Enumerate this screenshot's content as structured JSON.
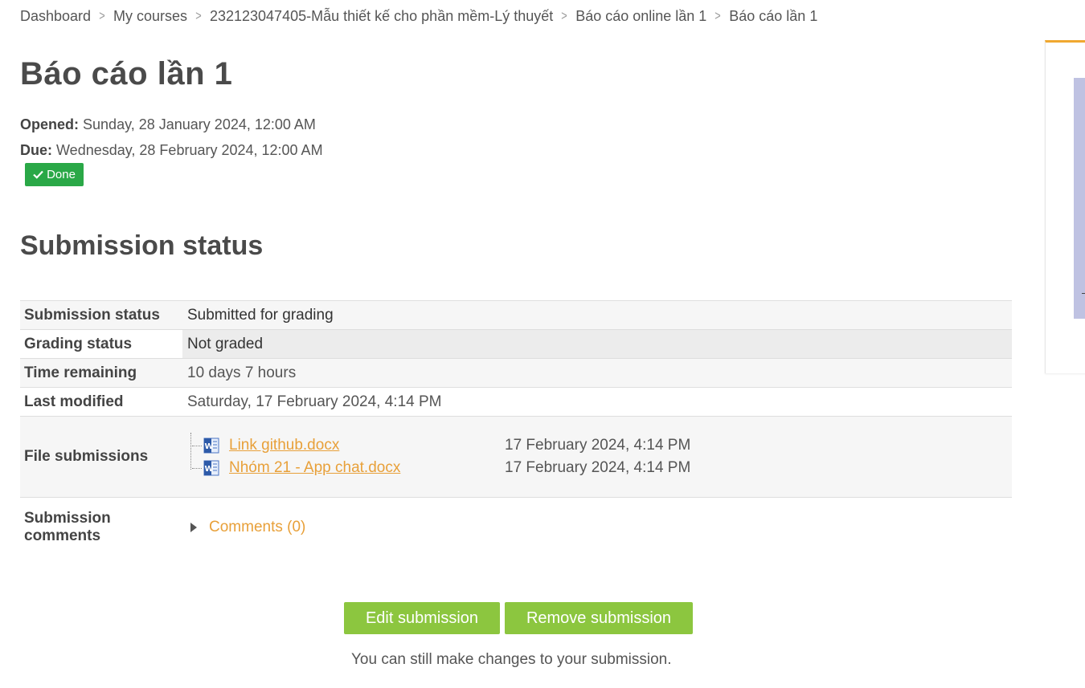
{
  "breadcrumb": {
    "items": [
      "Dashboard",
      "My courses",
      "232123047405-Mẫu thiết kế cho phần mềm-Lý thuyết",
      "Báo cáo online lần 1",
      "Báo cáo lần 1"
    ],
    "separator_icon": "chevron-right-icon"
  },
  "page": {
    "title": "Báo cáo lần 1",
    "opened_label": "Opened:",
    "opened_value": "Sunday, 28 January 2024, 12:00 AM",
    "due_label": "Due:",
    "due_value": "Wednesday, 28 February 2024, 12:00 AM",
    "done_badge": "Done",
    "done_icon": "check-icon",
    "done_color": "#2aa847"
  },
  "submission": {
    "heading": "Submission status",
    "rows": {
      "status": {
        "label": "Submission status",
        "value": "Submitted for grading"
      },
      "grading": {
        "label": "Grading status",
        "value": "Not graded"
      },
      "time": {
        "label": "Time remaining",
        "value": "10 days 7 hours"
      },
      "modified": {
        "label": "Last modified",
        "value": "Saturday, 17 February 2024, 4:14 PM"
      },
      "files": {
        "label": "File submissions",
        "items": [
          {
            "name": "Link github.docx",
            "date": "17 February 2024, 4:14 PM",
            "icon": "word-document-icon"
          },
          {
            "name": "Nhóm 21 - App chat.docx",
            "date": "17 February 2024, 4:14 PM",
            "icon": "word-document-icon"
          }
        ]
      },
      "comments": {
        "label": "Submission comments",
        "toggle": "Comments (0)",
        "icon": "caret-right-icon"
      }
    }
  },
  "actions": {
    "edit": "Edit submission",
    "remove": "Remove submission",
    "button_color": "#8cc63f",
    "note": "You can still make changes to your submission."
  },
  "colors": {
    "link": "#e8a039",
    "accent": "#f0a830"
  }
}
